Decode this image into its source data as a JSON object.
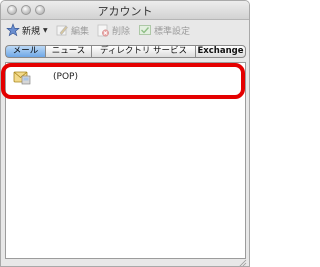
{
  "window": {
    "title": "アカウント"
  },
  "toolbar": {
    "new_label": "新規",
    "edit_label": "編集",
    "delete_label": "削除",
    "default_label": "標準設定"
  },
  "tabs": [
    {
      "label": "メール",
      "active": true
    },
    {
      "label": "ニュース",
      "active": false
    },
    {
      "label": "ディレクトリ サービス",
      "active": false
    },
    {
      "label": "Exchange",
      "active": false
    }
  ],
  "accounts": [
    {
      "name": "(POP)",
      "icon": "mail-account-icon"
    }
  ],
  "colors": {
    "highlight": "#e40000",
    "active_tab": "#6ea7e6"
  }
}
